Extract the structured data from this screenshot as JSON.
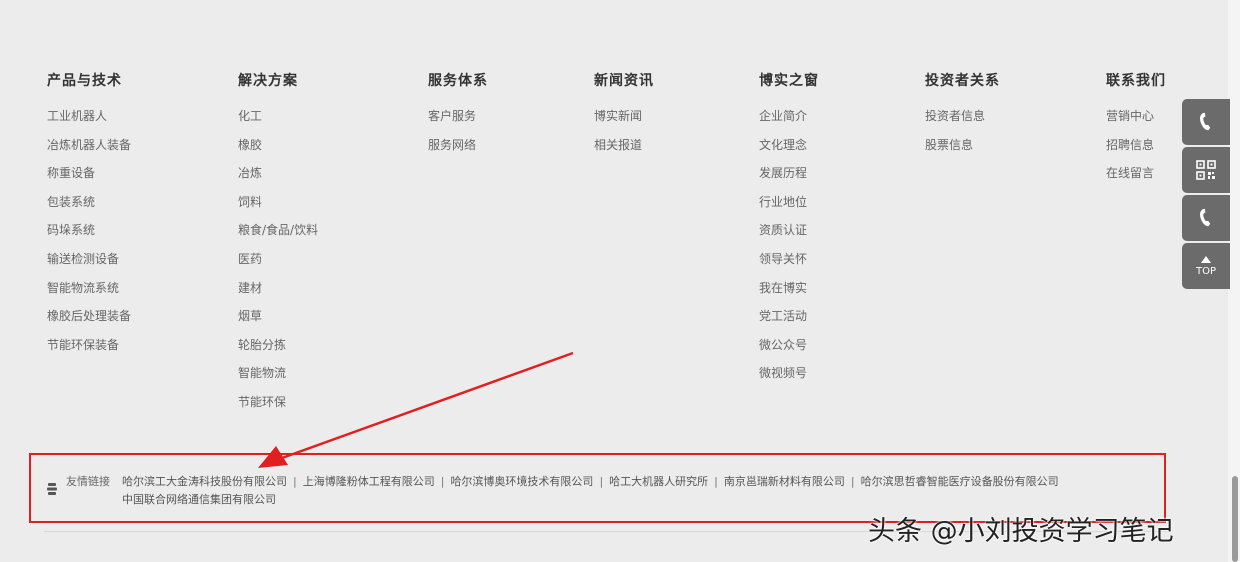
{
  "footer": {
    "columns": [
      {
        "title": "产品与技术",
        "links": [
          "工业机器人",
          "冶炼机器人装备",
          "称重设备",
          "包装系统",
          "码垛系统",
          "输送检测设备",
          "智能物流系统",
          "橡胶后处理装备",
          "节能环保装备"
        ]
      },
      {
        "title": "解决方案",
        "links": [
          "化工",
          "橡胶",
          "冶炼",
          "饲料",
          "粮食/食品/饮料",
          "医药",
          "建材",
          "烟草",
          "轮胎分拣",
          "智能物流",
          "节能环保"
        ]
      },
      {
        "title": "服务体系",
        "links": [
          "客户服务",
          "服务网络"
        ]
      },
      {
        "title": "新闻资讯",
        "links": [
          "博实新闻",
          "相关报道"
        ]
      },
      {
        "title": "博实之窗",
        "links": [
          "企业简介",
          "文化理念",
          "发展历程",
          "行业地位",
          "资质认证",
          "领导关怀",
          "我在博实",
          "党工活动",
          "微公众号",
          "微视频号"
        ]
      },
      {
        "title": "投资者关系",
        "links": [
          "投资者信息",
          "股票信息"
        ]
      },
      {
        "title": "联系我们",
        "links": [
          "营销中心",
          "招聘信息",
          "在线留言"
        ]
      }
    ],
    "friend_links": {
      "label": "友情链接",
      "items": [
        "哈尔滨工大金涛科技股份有限公司",
        "上海博隆粉体工程有限公司",
        "哈尔滨博奥环境技术有限公司",
        "哈工大机器人研究所",
        "南京邕瑞新材料有限公司",
        "哈尔滨思哲睿智能医疗设备股份有限公司",
        "中国联合网络通信集团有限公司"
      ],
      "separator": "|"
    }
  },
  "side_tools": {
    "phone_icon": "phone-icon",
    "qr_icon": "qrcode-icon",
    "top_label": "TOP"
  },
  "annotation": {
    "color": "#e02020"
  },
  "watermark": "头条 @小刘投资学习笔记"
}
